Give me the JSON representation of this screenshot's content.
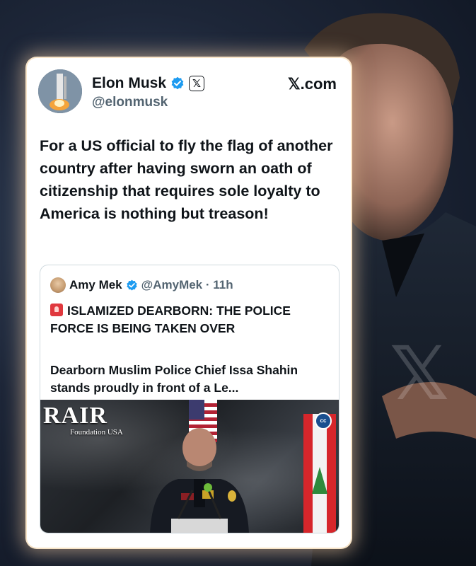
{
  "background": {
    "watermark_glyph": "𝕏"
  },
  "tweet": {
    "author_name": "Elon Musk",
    "verified_icon": "verified-badge-icon",
    "x_badge": "𝕏",
    "handle": "@elonmusk",
    "site": "𝕏.com",
    "text": "For a US official to fly the flag of another country after having sworn an oath of citizenship that requires sole loyalty to America is nothing but treason!"
  },
  "quoted_tweet": {
    "author_name": "Amy Mek",
    "handle_time": "@AmyMek · 11h",
    "headline": "ISLAMIZED DEARBORN: THE POLICE FORCE IS BEING TAKEN OVER",
    "headline_icon": "siren-icon",
    "body": "Dearborn Muslim Police Chief Issa Shahin stands proudly in front of a Le...",
    "media": {
      "logo_text": "RAIR",
      "logo_sub": "Foundation USA",
      "cc_label": "cc"
    }
  },
  "colors": {
    "verified": "#1d9bf0",
    "text_primary": "#0f1419",
    "text_secondary": "#536471",
    "card_glow": "#ffd6aa"
  }
}
